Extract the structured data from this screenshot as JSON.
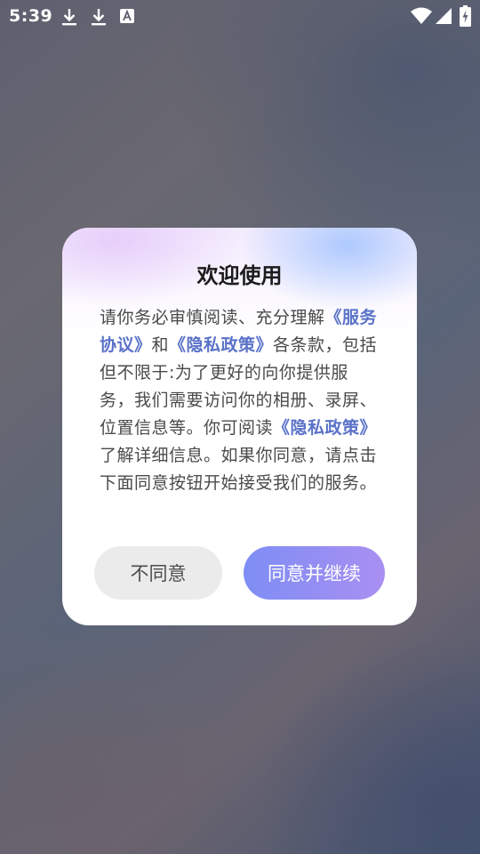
{
  "status_bar": {
    "time": "5:39",
    "icons": [
      "download-icon",
      "download-icon",
      "text-a-icon",
      "wifi-icon",
      "signal-icon",
      "battery-charging-icon"
    ]
  },
  "dialog": {
    "title": "欢迎使用",
    "body": {
      "p1": "请你务必审慎阅读、充分理解",
      "link_terms": "《服务协议》",
      "p2": "和",
      "link_privacy": "《隐私政策》",
      "p3": "各条款，包括但不限于:为了更好的向你提供服务，我们需要访问你的相册、录屏、位置信息等。你可阅读",
      "link_privacy_2": "《隐私政策》",
      "p4": "了解详细信息。如果你同意，请点击下面同意按钮开始接受我们的服务。"
    },
    "disagree_label": "不同意",
    "agree_label": "同意并继续"
  },
  "colors": {
    "link": "#5a72c8",
    "agree_start": "#7e8ef4",
    "agree_end": "#a98ff2",
    "disagree_bg": "#ebebeb"
  }
}
